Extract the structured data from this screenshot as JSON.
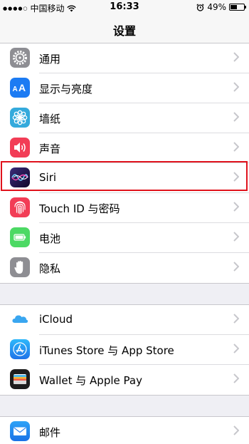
{
  "status": {
    "carrier": "中国移动",
    "time": "16:33",
    "battery": "49%",
    "battery_level": 0.49
  },
  "nav": {
    "title": "设置"
  },
  "groups": [
    {
      "rows": [
        {
          "label": "通用",
          "icon": "gear-icon",
          "color": "#8e8e93"
        },
        {
          "label": "显示与亮度",
          "icon": "text-size-icon",
          "color": "#1c7bf3"
        },
        {
          "label": "墙纸",
          "icon": "flower-icon",
          "color": "#34aadc"
        },
        {
          "label": "声音",
          "icon": "speaker-icon",
          "color": "#f23d56"
        },
        {
          "label": "Siri",
          "icon": "siri-icon",
          "color": "#2a1a56"
        },
        {
          "label": "Touch ID 与密码",
          "icon": "fingerprint-icon",
          "color": "#f23d56"
        },
        {
          "label": "电池",
          "icon": "battery-icon",
          "color": "#4cd964"
        },
        {
          "label": "隐私",
          "icon": "hand-icon",
          "color": "#8e8e93"
        }
      ]
    },
    {
      "rows": [
        {
          "label": "iCloud",
          "icon": "cloud-icon",
          "color": "#ffffff"
        },
        {
          "label": "iTunes Store 与 App Store",
          "icon": "app-store-icon",
          "color": "#1e9af2"
        },
        {
          "label": "Wallet 与 Apple Pay",
          "icon": "wallet-icon",
          "color": "#1d1d1d"
        }
      ]
    },
    {
      "rows": [
        {
          "label": "邮件",
          "icon": "mail-icon",
          "color": "#1e8bf3"
        }
      ]
    }
  ],
  "highlight_color": "#e0121c"
}
